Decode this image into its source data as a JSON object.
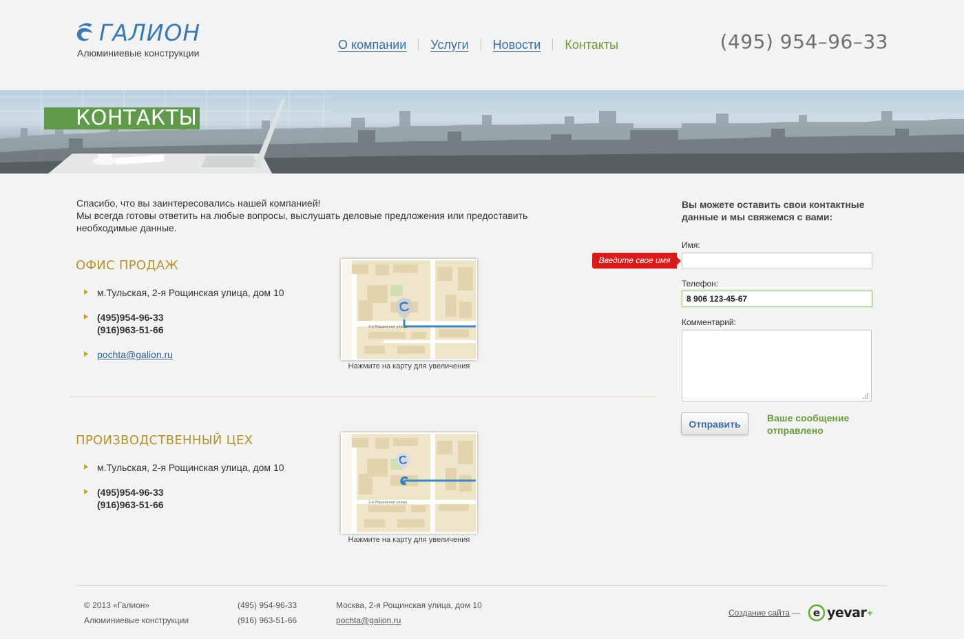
{
  "brand": {
    "name": "ГАЛИОН",
    "tagline": "Алюминиевые конструкции",
    "accent_color": "#3a79b5"
  },
  "nav": {
    "items": [
      {
        "label": "О компании",
        "active": false
      },
      {
        "label": "Услуги",
        "active": false
      },
      {
        "label": "Новости",
        "active": false
      },
      {
        "label": "Контакты",
        "active": true
      }
    ]
  },
  "header": {
    "phone": "(495) 954–96–33"
  },
  "banner": {
    "title": "КОНТАКТЫ"
  },
  "intro": {
    "line1": "Спасибо, что вы заинтересовались нашей компанией!",
    "line2": "Мы всегда готовы ответить на любые вопросы, выслушать деловые предложения или предоставить необходимые данные."
  },
  "offices": [
    {
      "title": "ОФИС ПРОДАЖ",
      "address": "м.Тульская, 2-я Рощинская улица, дом 10",
      "phone1": "(495)954-96-33",
      "phone2": "(916)963-51-66",
      "email": "pochta@galion.ru",
      "map_caption": "Нажмите на карту для увеличения",
      "map_street": "2-я Рощинская улица"
    },
    {
      "title": "ПРОИЗВОДСТВЕННЫЙ ЦЕХ",
      "address": "м.Тульская, 2-я Рощинская улица, дом 10",
      "phone1": "(495)954-96-33",
      "phone2": "(916)963-51-66",
      "map_caption": "Нажмите на карту для увеличения",
      "map_street": "2-я Рощинская улица"
    }
  ],
  "form": {
    "lead": "Вы можете оставить свои контактные данные и мы свяжемся с вами:",
    "name_label": "Имя:",
    "name_value": "",
    "name_error": "Введите свое имя",
    "phone_label": "Телефон:",
    "phone_value": "8 906 123-45-67",
    "comment_label": "Комментарий:",
    "comment_value": "",
    "submit_label": "Отправить",
    "sent_message": "Ваше сообщение отправлено",
    "error_color": "#d91b1b",
    "success_color": "#6a9b3a"
  },
  "footer": {
    "copyright": "© 2013  «Галион»",
    "tagline": "Алюминиевые конструкции",
    "phone1": "(495) 954-96-33",
    "phone2": "(916) 963-51-66",
    "address": "Москва, 2-я Рощинская улица, дом 10",
    "email": "pochta@galion.ru",
    "credit_link": "Создание сайта",
    "credit_dash": "—",
    "credit_brand": "yevar"
  }
}
